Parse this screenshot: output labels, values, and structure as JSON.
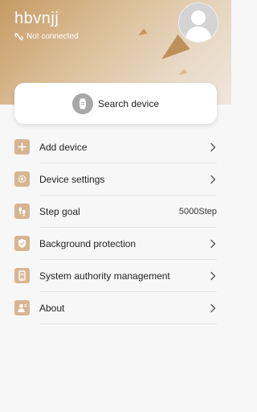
{
  "header": {
    "username": "hbvnjj",
    "status": "Not connected"
  },
  "search": {
    "label": "Search device"
  },
  "menu": {
    "items": [
      {
        "label": "Add device",
        "value": ""
      },
      {
        "label": "Device settings",
        "value": ""
      },
      {
        "label": "Step goal",
        "value": "5000Step"
      },
      {
        "label": "Background protection",
        "value": ""
      },
      {
        "label": "System authority management",
        "value": ""
      },
      {
        "label": "About",
        "value": ""
      }
    ]
  },
  "colors": {
    "header_gold": "#c69a63",
    "icon_tile": "#d6b591",
    "background": "#f7f7f7"
  },
  "icons": [
    "link-off-icon",
    "avatar-icon",
    "watch-icon",
    "plus-icon",
    "gear-icon",
    "footsteps-icon",
    "shield-icon",
    "phone-icon",
    "person-icon",
    "chevron-right-icon"
  ]
}
